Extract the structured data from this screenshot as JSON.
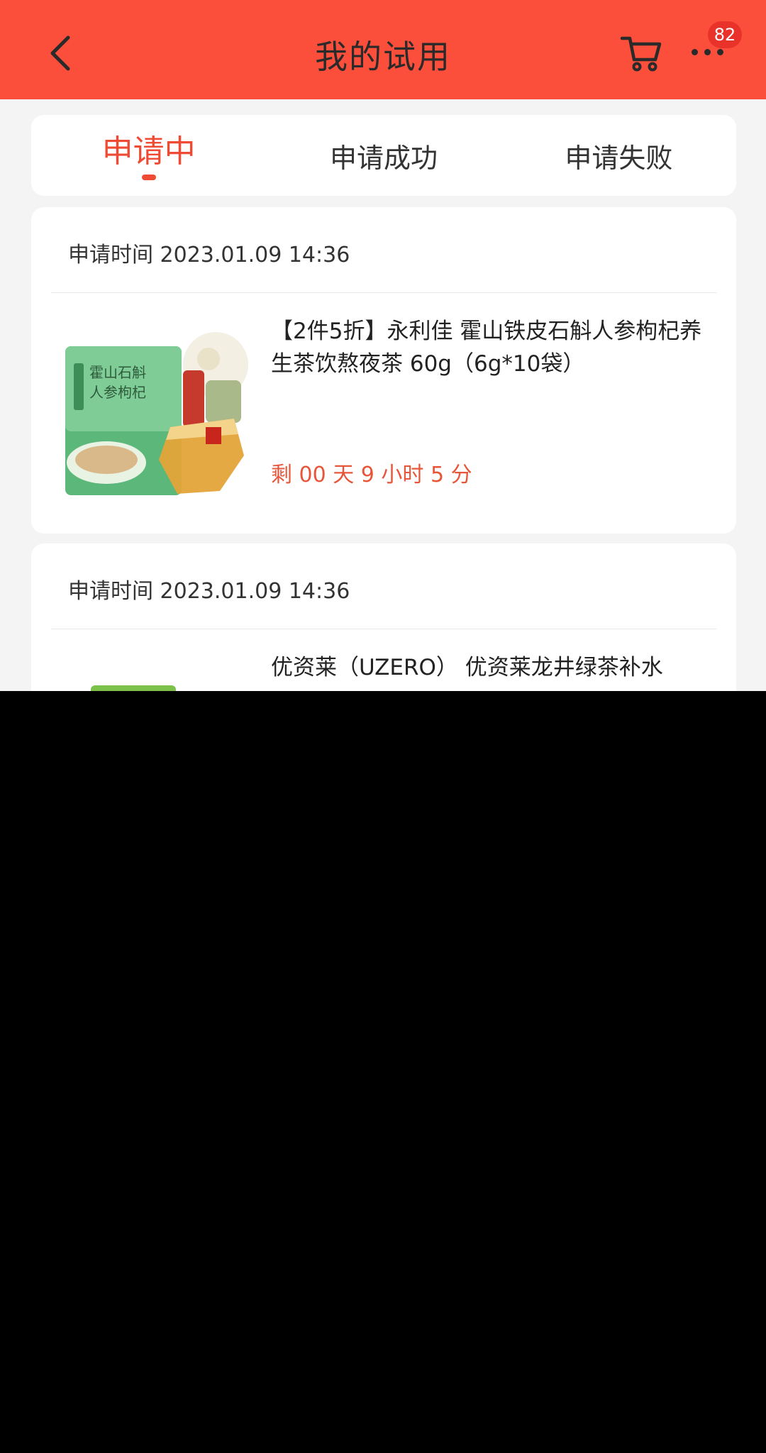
{
  "header": {
    "title": "我的试用",
    "cart_badge": "82",
    "accent_color": "#fb4f3c"
  },
  "tabs": [
    {
      "label": "申请中",
      "active": true
    },
    {
      "label": "申请成功",
      "active": false
    },
    {
      "label": "申请失败",
      "active": false
    }
  ],
  "trials": [
    {
      "apply_time": "申请时间 2023.01.09 14:36",
      "product_name": "【2件5折】永利佳 霍山铁皮石斛人参枸杞养生茶饮熬夜茶 60g（6g*10袋）",
      "countdown": "剩 00 天 9 小时 5 分",
      "image_icon": "product-tea-package-image"
    },
    {
      "apply_time": "申请时间 2023.01.09 14:36",
      "product_name": "优资莱（UZERO） 优资莱龙井绿茶补水",
      "image_icon": "product-thumbnail-image"
    }
  ]
}
